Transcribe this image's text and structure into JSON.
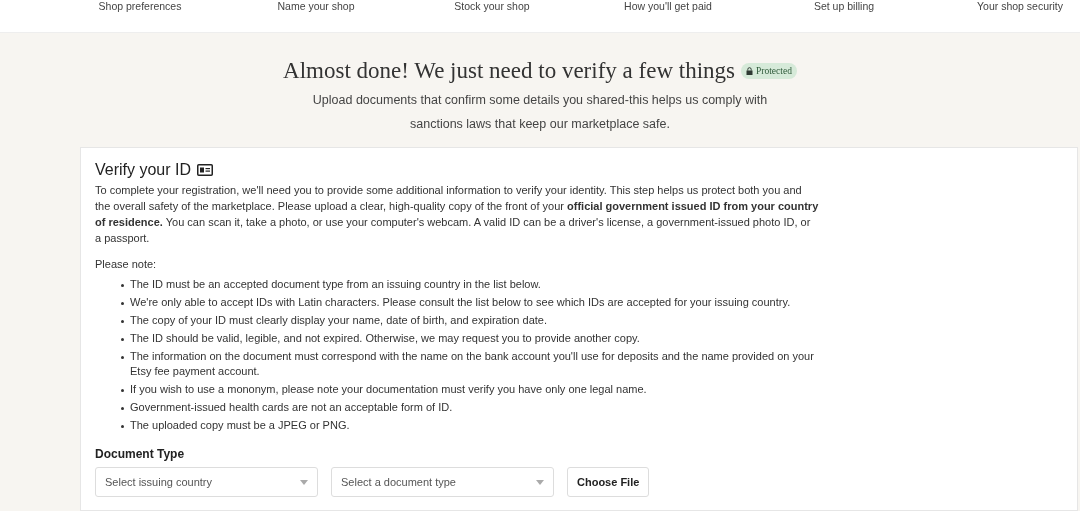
{
  "steps": [
    {
      "label": "Shop preferences"
    },
    {
      "label": "Name your shop"
    },
    {
      "label": "Stock your shop"
    },
    {
      "label": "How you'll get paid"
    },
    {
      "label": "Set up billing"
    },
    {
      "label": "Your shop security"
    }
  ],
  "header": {
    "title": "Almost done! We just need to verify a few things",
    "badge": "Protected",
    "subtitle": "Upload documents that confirm some details you shared-this helps us comply with sanctions laws that keep our marketplace safe."
  },
  "card": {
    "title": "Verify your ID",
    "intro": "To complete your registration, we'll need you to provide some additional information to verify your identity. This step helps us protect both you and the overall safety of the marketplace. Please upload a clear, high-quality copy of the front of your **official government issued ID from your country of residence.** You can scan it, take a photo, or use your computer's webcam. A valid ID can be a driver's license, a government-issued photo ID, or a passport.",
    "note_label": "Please note:",
    "notes": [
      "The ID must be an accepted document type from an issuing country in the list below.",
      "We're only able to accept IDs with Latin characters. Please consult the list below to see which IDs are accepted for your issuing country.",
      "The copy of your ID must clearly display your name, date of birth, and expiration date.",
      "The ID should be valid, legible, and not expired. Otherwise, we may request you to provide another copy.",
      "The information on the document must correspond with the name on the bank account you'll use for deposits and the name provided on your Etsy fee payment account.",
      "If you wish to use a mononym, please note your documentation must verify you have only one legal name.",
      "Government-issued health cards are not an acceptable form of ID.",
      "The uploaded copy must be a JPEG or PNG."
    ],
    "document_type": {
      "label": "Document Type",
      "selects": [
        {
          "placeholder": "Select issuing country"
        },
        {
          "placeholder": "Select a document type"
        }
      ],
      "button": "Choose File"
    }
  }
}
